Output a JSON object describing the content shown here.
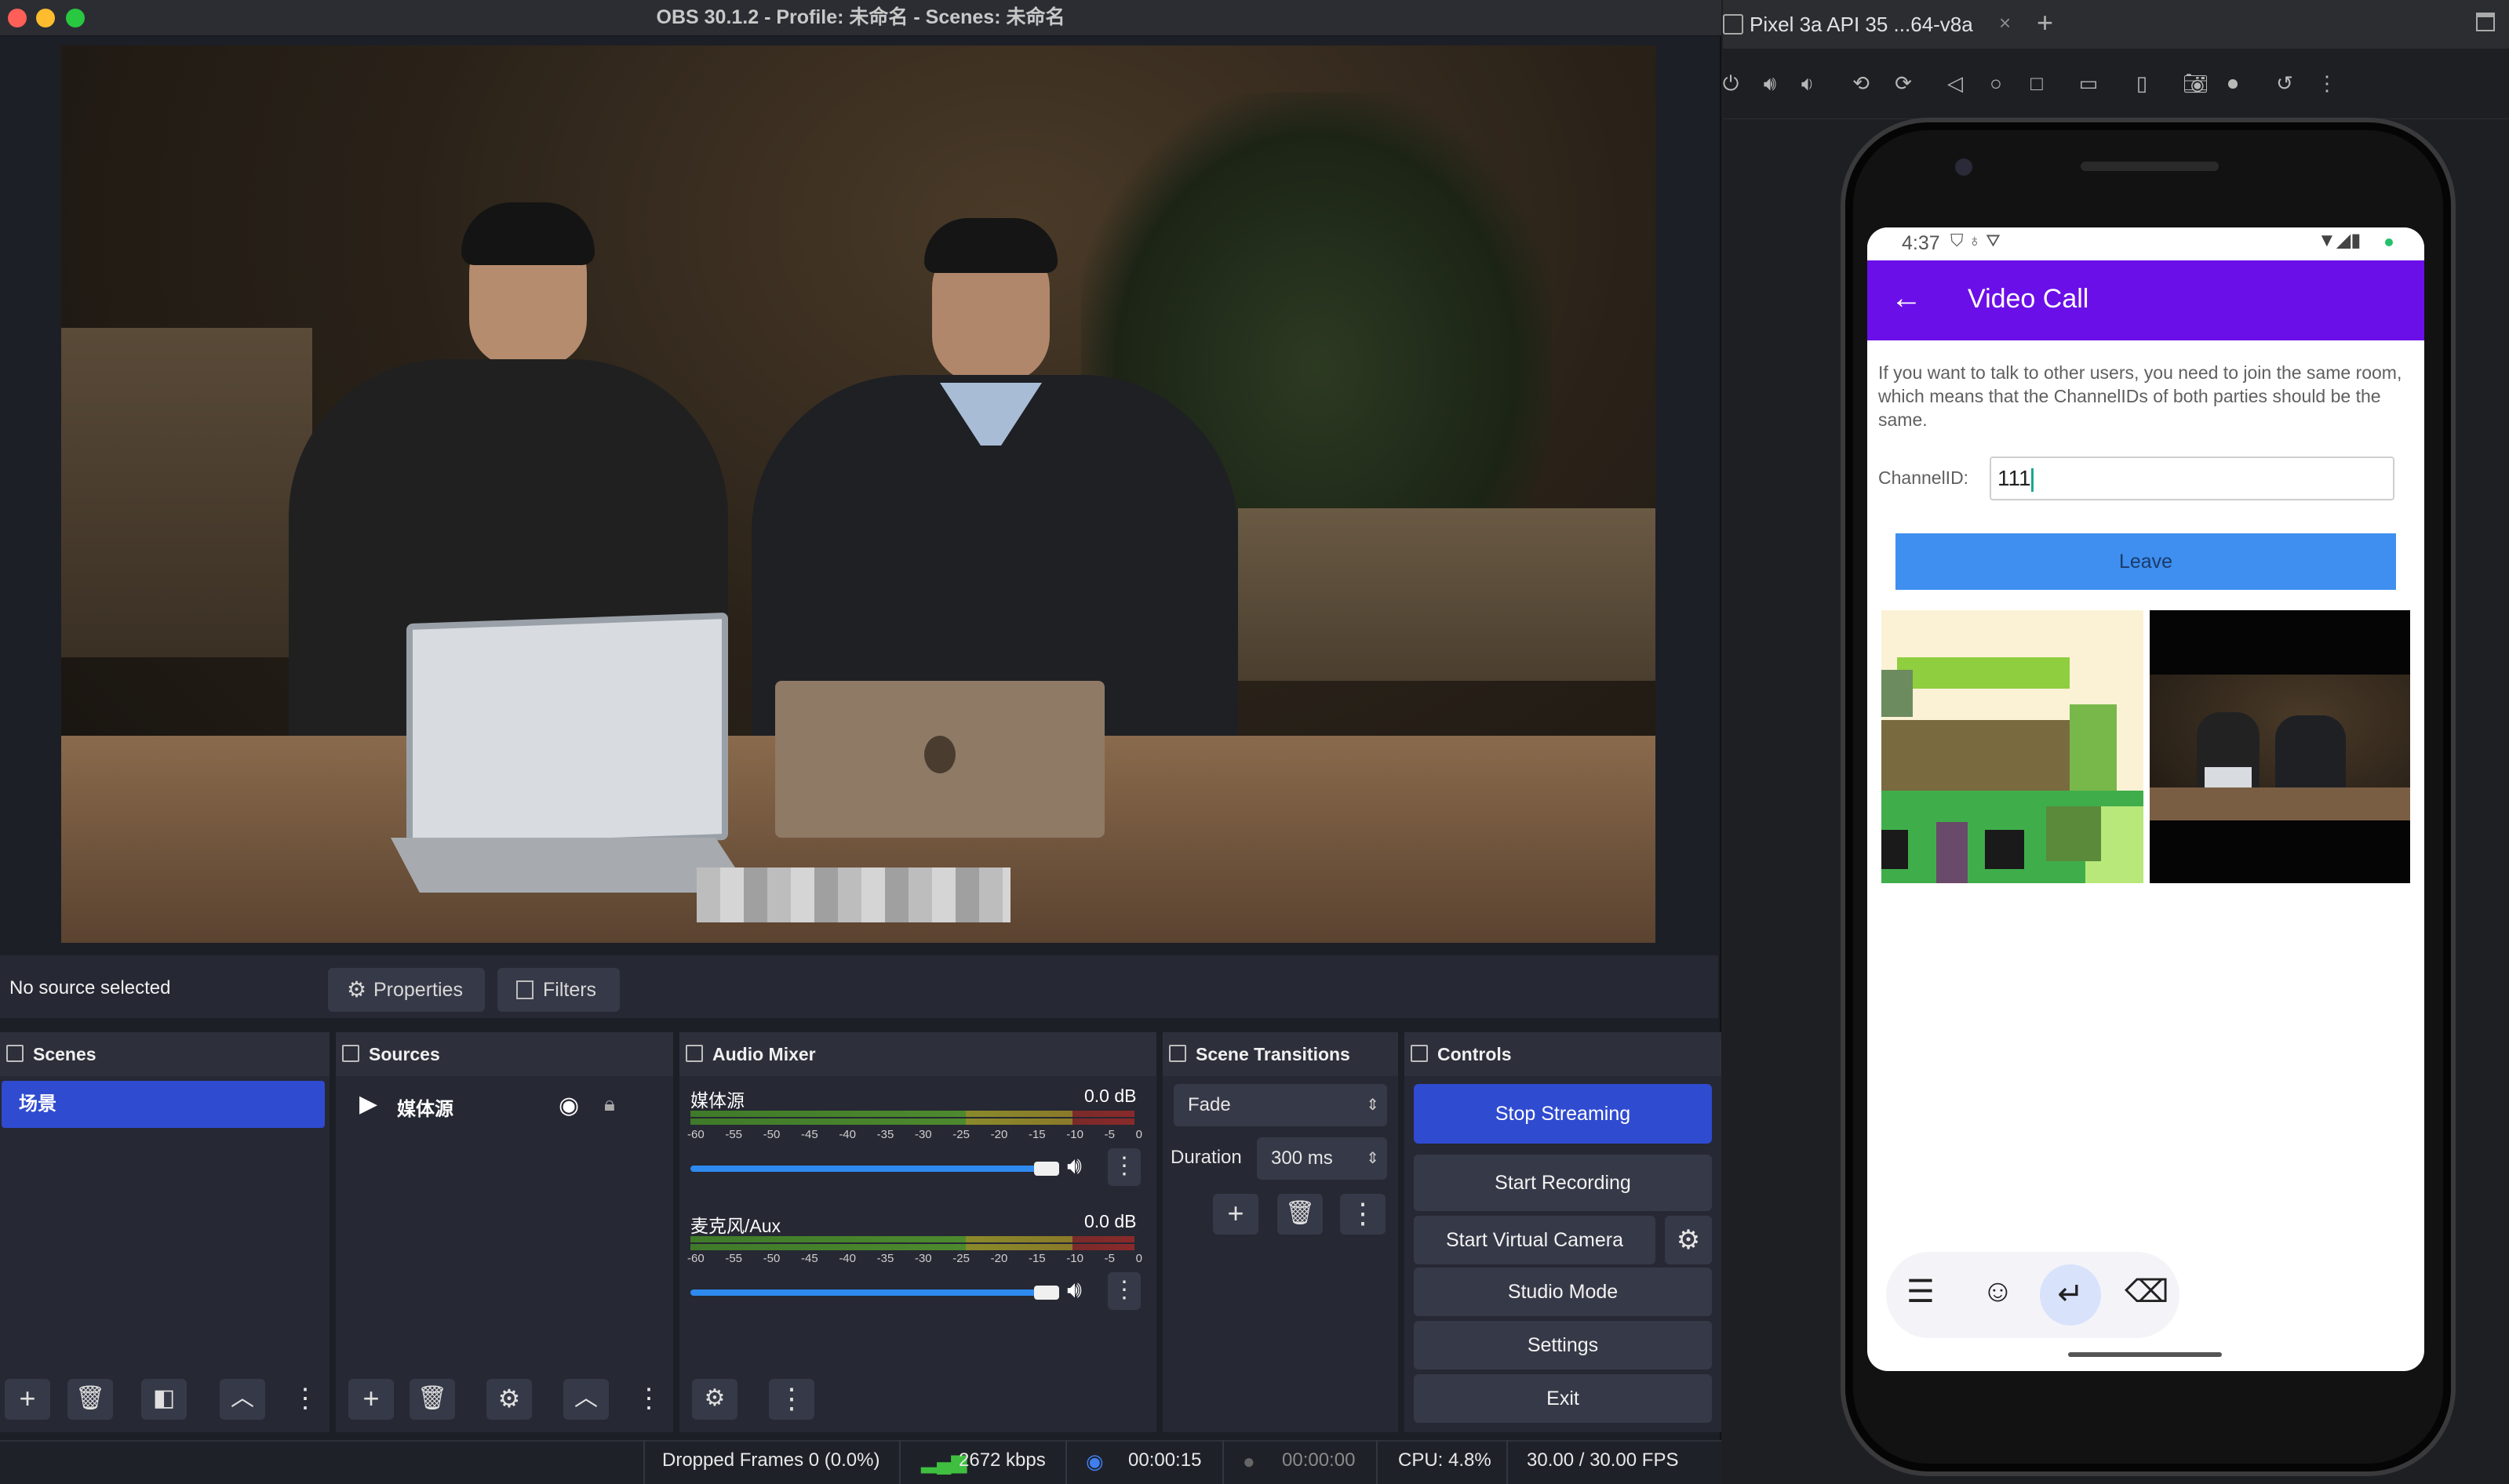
{
  "obs": {
    "window_title": "OBS 30.1.2 - Profile: 未命名 - Scenes: 未命名",
    "no_source": "No source selected",
    "properties_label": "Properties",
    "filters_label": "Filters",
    "docks": {
      "scenes": {
        "title": "Scenes",
        "items": [
          "场景"
        ]
      },
      "sources": {
        "title": "Sources",
        "items": [
          "媒体源"
        ]
      },
      "audio_mixer": {
        "title": "Audio Mixer",
        "channels": [
          {
            "name": "媒体源",
            "level": "0.0 dB"
          },
          {
            "name": "麦克风/Aux",
            "level": "0.0 dB"
          }
        ],
        "ticks": [
          "-60",
          "-55",
          "-50",
          "-45",
          "-40",
          "-35",
          "-30",
          "-25",
          "-20",
          "-15",
          "-10",
          "-5",
          "0"
        ]
      },
      "scene_transitions": {
        "title": "Scene Transitions",
        "transition": "Fade",
        "duration_label": "Duration",
        "duration_value": "300 ms"
      },
      "controls": {
        "title": "Controls",
        "stop_streaming": "Stop Streaming",
        "start_recording": "Start Recording",
        "start_virtual_camera": "Start Virtual Camera",
        "studio_mode": "Studio Mode",
        "settings": "Settings",
        "exit": "Exit"
      }
    },
    "status": {
      "dropped_frames": "Dropped Frames 0 (0.0%)",
      "bitrate": "2672 kbps",
      "stream_time": "00:00:15",
      "record_time": "00:00:00",
      "cpu": "CPU: 4.8%",
      "fps": "30.00 / 30.00 FPS"
    },
    "colors": {
      "accent": "#2f4bd0",
      "panel": "#262833",
      "stop_streaming": "#2f4bd0"
    }
  },
  "emulator": {
    "tab_title": "Pixel 3a API 35 ...64-v8a",
    "phone": {
      "time": "4:37",
      "app_title": "Video Call",
      "info_text": "If you want to talk to other users, you need to join the same room, which means that the ChannelIDs of both parties should be the same.",
      "channel_label": "ChannelID:",
      "channel_value": "111",
      "leave_button": "Leave",
      "colors": {
        "appbar": "#6b0fe8",
        "leave": "#3e8fef"
      }
    }
  }
}
